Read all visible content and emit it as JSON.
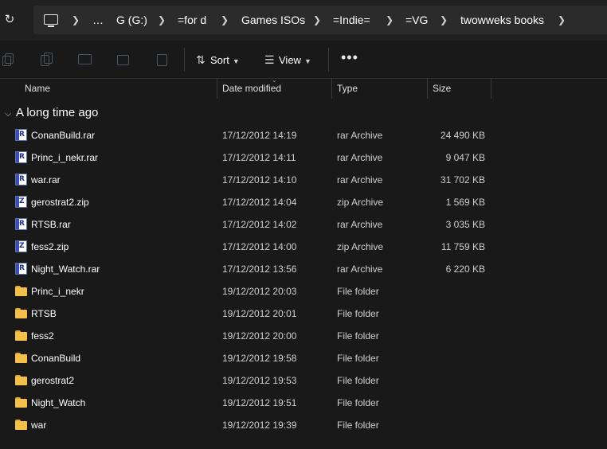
{
  "breadcrumbs": [
    "…",
    "G (G:)",
    "=for d",
    "Games ISOs",
    "=Indie=",
    "=VG",
    "twowweks books"
  ],
  "toolbar": {
    "sort_label": "Sort",
    "view_label": "View",
    "more_label": "•••"
  },
  "columns": {
    "name": "Name",
    "date": "Date modified",
    "type": "Type",
    "size": "Size"
  },
  "group_label": "A long time ago",
  "files": [
    {
      "name": "ConanBuild.rar",
      "date": "17/12/2012 14:19",
      "type": "rar Archive",
      "size": "24 490 KB",
      "icon": "R"
    },
    {
      "name": "Princ_i_nekr.rar",
      "date": "17/12/2012 14:11",
      "type": "rar Archive",
      "size": "9 047 KB",
      "icon": "R"
    },
    {
      "name": "war.rar",
      "date": "17/12/2012 14:10",
      "type": "rar Archive",
      "size": "31 702 KB",
      "icon": "R"
    },
    {
      "name": "gerostrat2.zip",
      "date": "17/12/2012 14:04",
      "type": "zip Archive",
      "size": "1 569 KB",
      "icon": "Z"
    },
    {
      "name": "RTSB.rar",
      "date": "17/12/2012 14:02",
      "type": "rar Archive",
      "size": "3 035 KB",
      "icon": "R"
    },
    {
      "name": "fess2.zip",
      "date": "17/12/2012 14:00",
      "type": "zip Archive",
      "size": "11 759 KB",
      "icon": "Z"
    },
    {
      "name": "Night_Watch.rar",
      "date": "17/12/2012 13:56",
      "type": "rar Archive",
      "size": "6 220 KB",
      "icon": "R"
    },
    {
      "name": "Princ_i_nekr",
      "date": "19/12/2012 20:03",
      "type": "File folder",
      "size": ""
    },
    {
      "name": "RTSB",
      "date": "19/12/2012 20:01",
      "type": "File folder",
      "size": ""
    },
    {
      "name": "fess2",
      "date": "19/12/2012 20:00",
      "type": "File folder",
      "size": ""
    },
    {
      "name": "ConanBuild",
      "date": "19/12/2012 19:58",
      "type": "File folder",
      "size": ""
    },
    {
      "name": "gerostrat2",
      "date": "19/12/2012 19:53",
      "type": "File folder",
      "size": ""
    },
    {
      "name": "Night_Watch",
      "date": "19/12/2012 19:51",
      "type": "File folder",
      "size": ""
    },
    {
      "name": "war",
      "date": "19/12/2012 19:39",
      "type": "File folder",
      "size": ""
    }
  ]
}
